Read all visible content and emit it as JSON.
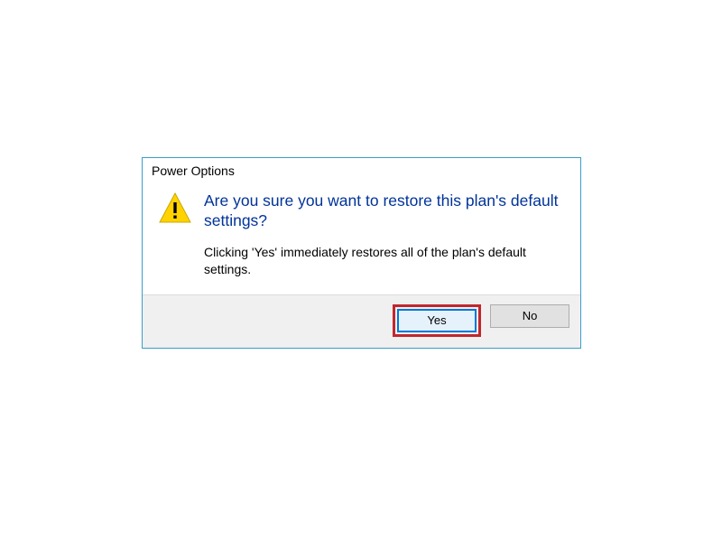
{
  "dialog": {
    "title": "Power Options",
    "question": "Are you sure you want to restore this plan's default settings?",
    "description": "Clicking 'Yes' immediately restores all of the plan's default settings.",
    "buttons": {
      "yes": "Yes",
      "no": "No"
    }
  }
}
